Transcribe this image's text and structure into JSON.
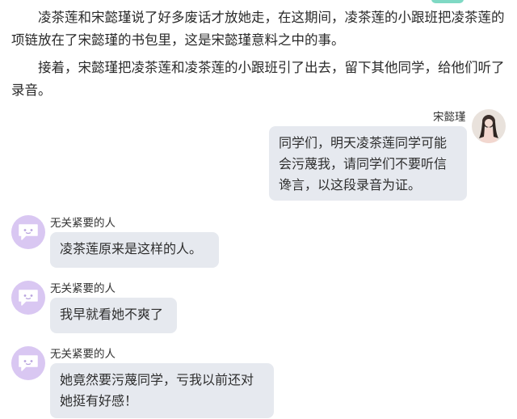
{
  "narration": [
    "凌茶莲和宋懿瑾说了好多废话才放她走，在这期间，凌茶莲的小跟班把凌茶莲的项链放在了宋懿瑾的书包里，这是宋懿瑾意料之中的事。",
    "接着，宋懿瑾把凌茶莲和凌茶莲的小跟班引了出去，留下其他同学，给他们听了录音。"
  ],
  "chat": {
    "self_message": {
      "sender": "宋懿瑾",
      "text": "同学们，明天凌茶莲同学可能会污蔑我，请同学们不要听信谗言，以这段录音为证。"
    },
    "other_messages": [
      {
        "sender": "无关紧要的人",
        "text": "凌茶莲原来是这样的人。"
      },
      {
        "sender": "无关紧要的人",
        "text": "我早就看她不爽了"
      },
      {
        "sender": "无关紧要的人",
        "text": "她竟然要污蔑同学，亏我以前还对她挺有好感！"
      }
    ]
  },
  "colors": {
    "bubble": "#e6e9ef",
    "bot_avatar": "#d9c7f2",
    "accent": "#7fd9c4"
  },
  "icons": {
    "self_avatar": "user-photo-avatar-icon",
    "other_avatar": "chat-bubble-face-icon"
  }
}
